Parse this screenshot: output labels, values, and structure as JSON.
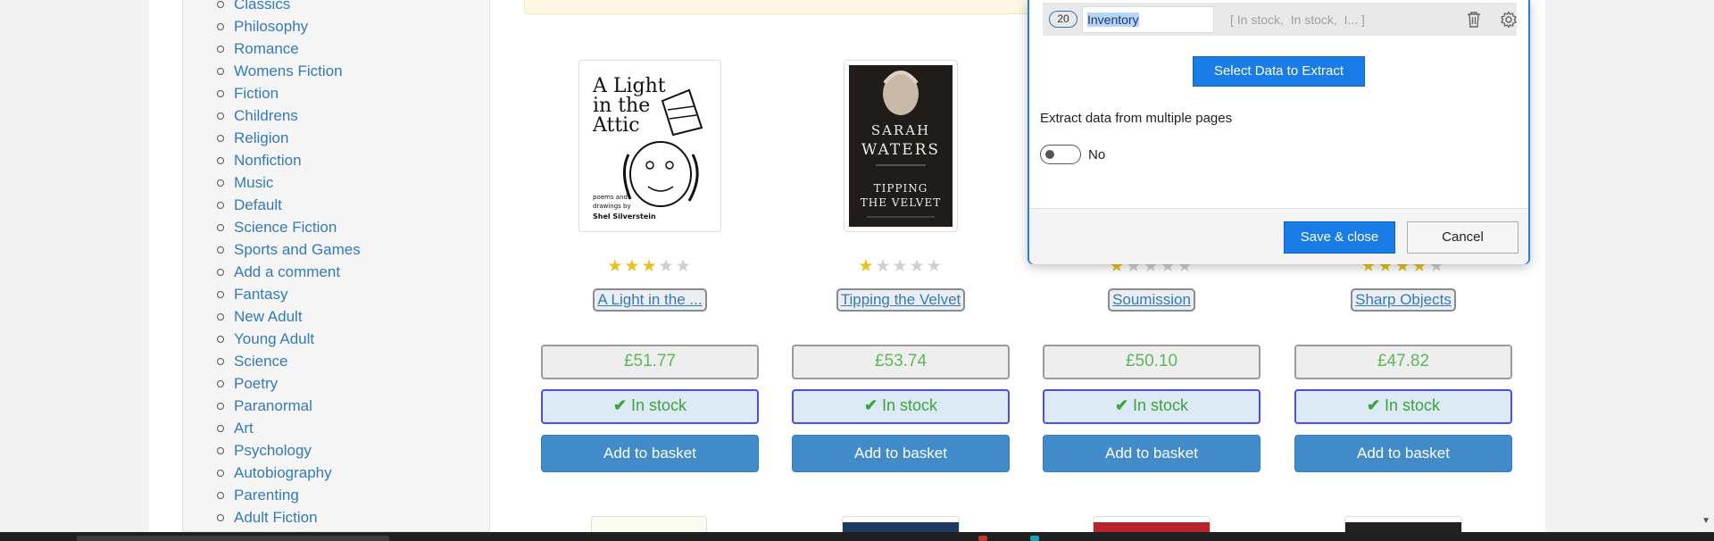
{
  "sidebar": {
    "categories": [
      "Classics",
      "Philosophy",
      "Romance",
      "Womens Fiction",
      "Fiction",
      "Childrens",
      "Religion",
      "Nonfiction",
      "Music",
      "Default",
      "Science Fiction",
      "Sports and Games",
      "Add a comment",
      "Fantasy",
      "New Adult",
      "Young Adult",
      "Science",
      "Poetry",
      "Paranormal",
      "Art",
      "Psychology",
      "Autobiography",
      "Parenting",
      "Adult Fiction"
    ]
  },
  "books": [
    {
      "title": "A Light in the ...",
      "rating": 3,
      "price": "£51.77",
      "availability": "In stock",
      "basket_label": "Add to basket",
      "cover": {
        "line1": "A Light",
        "line2": "in the",
        "line3": "Attic",
        "credit1": "poems and",
        "credit2": "drawings by",
        "author": "Shel Silverstein"
      }
    },
    {
      "title": "Tipping the Velvet",
      "rating": 1,
      "price": "£53.74",
      "availability": "In stock",
      "basket_label": "Add to basket",
      "cover": {
        "author1": "SARAH",
        "author2": "WATERS",
        "title1": "TIPPING",
        "title2": "THE VELVET"
      }
    },
    {
      "title": "Soumission",
      "rating": 1,
      "price": "£50.10",
      "availability": "In stock",
      "basket_label": "Add to basket"
    },
    {
      "title": "Sharp Objects",
      "rating": 4,
      "price": "£47.82",
      "availability": "In stock",
      "basket_label": "Add to basket"
    }
  ],
  "star_char": "★",
  "check_char": "✔",
  "extractor": {
    "field": {
      "count": "20",
      "name": "Inventory",
      "preview": "[ In stock,  In stock,  I... ]"
    },
    "select_button": "Select Data to Extract",
    "multi_page_label": "Extract data from multiple pages",
    "multi_page_value": "No",
    "multi_page_enabled": false,
    "save_button": "Save & close",
    "cancel_button": "Cancel"
  },
  "colors": {
    "link": "#337ab7",
    "price": "#5cb85c",
    "stock": "#3fa33f",
    "primary_button": "#1a7ce6",
    "basket_button": "#428bca"
  }
}
